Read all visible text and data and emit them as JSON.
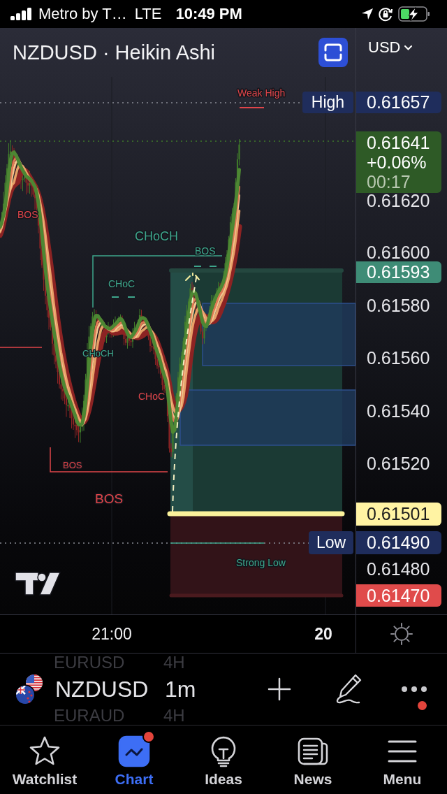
{
  "status_bar": {
    "carrier": "Metro by T…",
    "network": "LTE",
    "time": "10:49 PM"
  },
  "header": {
    "title": "NZDUSD · Heikin Ashi",
    "currency": "USD"
  },
  "chart": {
    "labels": [
      {
        "text": "Weak High",
        "color": "#e0454a"
      },
      {
        "text": "BOS",
        "color": "#e0454a"
      },
      {
        "text": "CHoCH",
        "color": "#3ea68c"
      },
      {
        "text": "BOS",
        "color": "#3ea68c"
      },
      {
        "text": "CHoC",
        "color": "#3ea68c"
      },
      {
        "text": "CHoCH",
        "color": "#3ea68c"
      },
      {
        "text": "CHoC",
        "color": "#e0454a"
      },
      {
        "text": "BOS",
        "color": "#e0454a"
      },
      {
        "text": "BOS",
        "color": "#e0454a"
      },
      {
        "text": "Strong Low",
        "color": "#3ea68c"
      }
    ],
    "markers": [
      {
        "text": "High"
      },
      {
        "text": "Low"
      }
    ]
  },
  "price_axis": {
    "ticks": [
      "0.61620",
      "0.61600",
      "0.61580",
      "0.61560",
      "0.61540",
      "0.61520",
      "0.61480"
    ],
    "badges": [
      {
        "kind": "single",
        "text": "0.61657",
        "color": "#1f2d5c"
      },
      {
        "kind": "last",
        "text": "0.61641",
        "change": "+0.06%",
        "countdown": "00:17",
        "color": "#2e5a26"
      },
      {
        "kind": "single",
        "text": "0.61593",
        "color": "#3e8c76"
      },
      {
        "kind": "single",
        "text": "0.61501",
        "color": "#fff3a3"
      },
      {
        "kind": "single",
        "text": "0.61490",
        "color": "#1f2d5c"
      },
      {
        "kind": "single",
        "text": "0.61470",
        "color": "#e04b4b"
      }
    ]
  },
  "time_axis": [
    {
      "text": "21:00",
      "kind": "time"
    },
    {
      "text": "20",
      "kind": "date"
    }
  ],
  "symbol_bar": {
    "previous": {
      "symbol": "EURUSD",
      "interval": "4H"
    },
    "current": {
      "symbol": "NZDUSD",
      "interval": "1m"
    },
    "next": {
      "symbol": "EURAUD",
      "interval": "4H"
    },
    "more_notification": true
  },
  "tabs": [
    {
      "label": "Watchlist",
      "selected": false,
      "notification": false
    },
    {
      "label": "Chart",
      "selected": true,
      "notification": true
    },
    {
      "label": "Ideas",
      "selected": false,
      "notification": false
    },
    {
      "label": "News",
      "selected": false,
      "notification": false
    },
    {
      "label": "Menu",
      "selected": false,
      "notification": false
    }
  ]
}
